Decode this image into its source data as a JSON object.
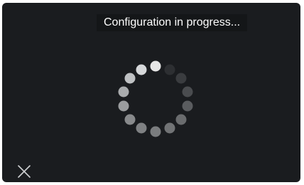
{
  "status": {
    "message": "Configuration in progress..."
  },
  "spinner": {
    "dot_count": 14,
    "dot_colors": [
      "#e6e6e6",
      "#2d2f32",
      "#3a3c3f",
      "#4a4c4f",
      "#5a5c5f",
      "#6a6c6e",
      "#717375",
      "#7a7c7e",
      "#7f8183",
      "#888a8c",
      "#9a9c9e",
      "#a9abad",
      "#bfc1c3",
      "#d6d8da"
    ]
  },
  "controls": {
    "close_icon": "close-icon"
  },
  "colors": {
    "screen_background": "#1a1c1f",
    "text": "#ffffff"
  }
}
